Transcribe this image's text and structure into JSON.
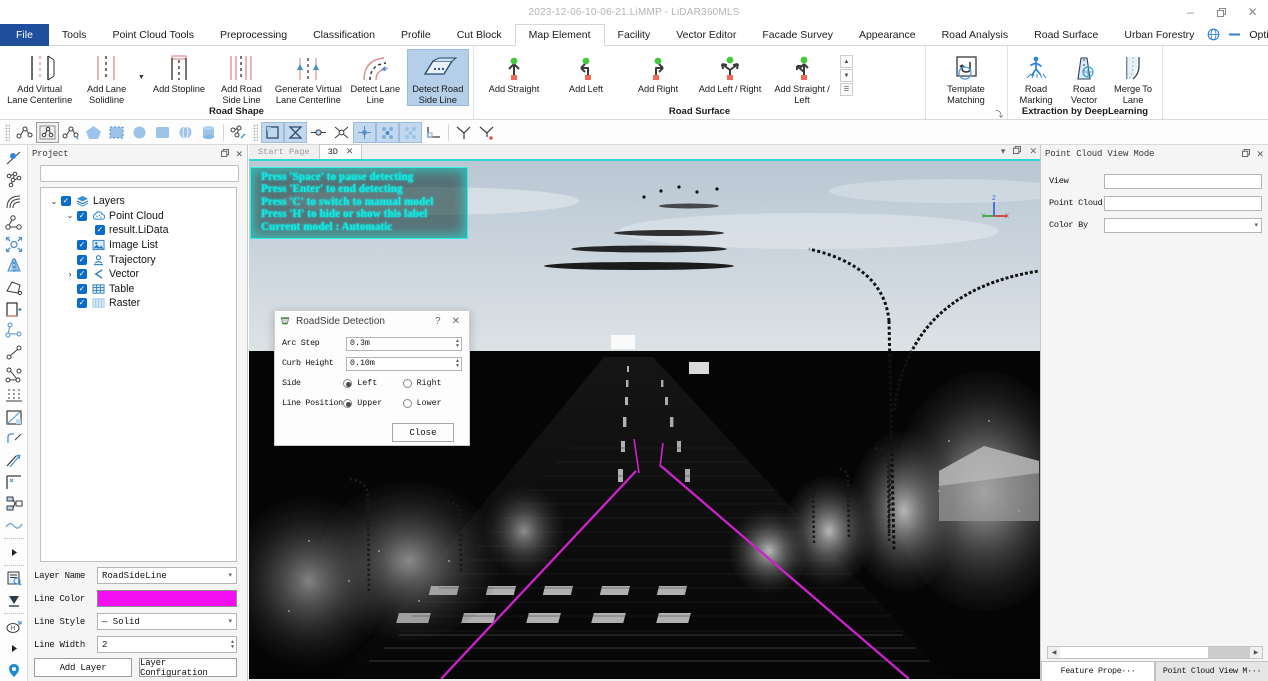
{
  "window": {
    "title": "2023-12-06-10-06-21.LiMMP - LiDAR360MLS",
    "minimize": "–",
    "restore": "❐",
    "close": "✕"
  },
  "ribbon_tabs": {
    "file": "File",
    "items": [
      {
        "label": "Tools",
        "active": false
      },
      {
        "label": "Point Cloud Tools",
        "active": false
      },
      {
        "label": "Preprocessing",
        "active": false
      },
      {
        "label": "Classification",
        "active": false
      },
      {
        "label": "Profile",
        "active": false
      },
      {
        "label": "Cut Block",
        "active": false
      },
      {
        "label": "Map Element",
        "active": true
      },
      {
        "label": "Facility",
        "active": false
      },
      {
        "label": "Vector Editor",
        "active": false
      },
      {
        "label": "Facade Survey",
        "active": false
      },
      {
        "label": "Appearance",
        "active": false
      },
      {
        "label": "Road Analysis",
        "active": false
      },
      {
        "label": "Road Surface",
        "active": false
      },
      {
        "label": "Urban Forestry",
        "active": false
      }
    ],
    "help_icon": "help-globe-icon",
    "minus_icon": "collapse-ribbon-icon",
    "options": "Options",
    "options_caret": "▾"
  },
  "ribbon_groups": [
    {
      "title": "Road Shape",
      "buttons": [
        {
          "label": "Add Virtual Lane Centerline",
          "icon": "lane-centerline-icon",
          "selected": false
        },
        {
          "label": "Add Lane Solidline",
          "icon": "lane-solidline-icon",
          "selected": false,
          "has_dropdown": true
        },
        {
          "label": "Add Stopline",
          "icon": "stopline-icon",
          "selected": false
        },
        {
          "label": "Add Road Side Line",
          "icon": "road-side-line-icon",
          "selected": false
        },
        {
          "label": "Generate Virtual Lane Centerline",
          "icon": "generate-virtual-centerline-icon",
          "selected": false
        },
        {
          "label": "Detect Lane Line",
          "icon": "detect-lane-line-icon",
          "selected": false
        },
        {
          "label": "Detect Road Side Line",
          "icon": "detect-road-side-line-icon",
          "selected": true
        }
      ]
    },
    {
      "title": "Road Surface",
      "buttons": [
        {
          "label": "Add Straight",
          "icon": "arrow-straight-icon",
          "selected": false
        },
        {
          "label": "Add Left",
          "icon": "arrow-left-icon",
          "selected": false
        },
        {
          "label": "Add Right",
          "icon": "arrow-right-icon",
          "selected": false
        },
        {
          "label": "Add Left / Right",
          "icon": "arrow-left-right-icon",
          "selected": false
        },
        {
          "label": "Add Straight / Left",
          "icon": "arrow-straight-left-icon",
          "selected": false
        }
      ],
      "has_gallery_scroll": true,
      "scroll_up": "▲",
      "scroll_down": "▼",
      "scroll_more": "☰"
    },
    {
      "title": "",
      "buttons": [
        {
          "label": "Template Matching",
          "icon": "template-matching-icon",
          "selected": false
        }
      ],
      "launcher": "⤵"
    },
    {
      "title": "Extraction by DeepLearning",
      "buttons": [
        {
          "label": "Road Marking",
          "icon": "road-marking-icon",
          "selected": false
        },
        {
          "label": "Road Vector",
          "icon": "road-vector-icon",
          "selected": false
        },
        {
          "label": "Merge To Lane",
          "icon": "merge-to-lane-icon",
          "selected": false
        }
      ]
    }
  ],
  "toolbar2": {
    "groups": [
      [
        "measure-polyline-icon",
        "measure-area-boxed-icon",
        "measure-angle-icon"
      ],
      [
        "polygon-select-icon",
        "rect-dashed-select-icon",
        "circle-select-icon",
        "square-select-icon",
        "sphere-select-icon",
        "cylinder-select-icon"
      ],
      [
        "edit-node-icon"
      ],
      [
        "box-view-icon",
        "hourglass-view-icon",
        "point-line-icon",
        "cross-node-icon",
        "diamond-node-icon",
        "dots-grid-icon",
        "dots-grid2-icon",
        "axis-corner-icon"
      ],
      [
        "angle-tool-icon",
        "angle-point-tool-icon"
      ]
    ],
    "active_indices": [
      0,
      1,
      4,
      5,
      6
    ]
  },
  "left_toolbar": {
    "icons": [
      "pick-point-icon",
      "point-chain-icon",
      "arc-icon",
      "node-link-icon",
      "expand-circle-icon",
      "mirror-icon",
      "polygon-edit-icon",
      "door-panel-icon",
      "node-tree-icon",
      "line-node-icon",
      "node-triangle-icon",
      "vertical-lines-icon",
      "rect-diagonal-icon",
      "curve-corner-icon",
      "arrow-line-icon",
      "corner-frame-icon",
      "hierarchy-icon",
      "wave-line-icon",
      "play-small-icon",
      "table-search-icon",
      "download-cloud-icon",
      "heading-cloud-icon",
      "play-small2-icon",
      "location-pin-icon"
    ]
  },
  "project_panel": {
    "title": "Project",
    "float_icon": "❐",
    "close_icon": "✕",
    "search_value": "",
    "tree": [
      {
        "label": "Layers",
        "depth": 0,
        "expander": "⌄",
        "checked": true,
        "icon": "layers-icon"
      },
      {
        "label": "Point Cloud",
        "depth": 1,
        "expander": "⌄",
        "checked": true,
        "icon": "point-cloud-icon"
      },
      {
        "label": "result.LiData",
        "depth": 2,
        "expander": "",
        "checked": true,
        "icon": ""
      },
      {
        "label": "Image List",
        "depth": 1,
        "expander": "",
        "checked": true,
        "icon": "image-list-icon"
      },
      {
        "label": "Trajectory",
        "depth": 1,
        "expander": "",
        "checked": true,
        "icon": "trajectory-icon"
      },
      {
        "label": "Vector",
        "depth": 1,
        "expander": "›",
        "checked": true,
        "icon": "vector-icon"
      },
      {
        "label": "Table",
        "depth": 1,
        "expander": "",
        "checked": true,
        "icon": "table-icon"
      },
      {
        "label": "Raster",
        "depth": 1,
        "expander": "",
        "checked": true,
        "icon": "raster-icon"
      }
    ]
  },
  "layer_props": {
    "layer_name_label": "Layer Name",
    "layer_name_value": "RoadSideLine",
    "line_color_label": "Line Color",
    "line_color_value": "#f40ef4",
    "line_style_label": "Line Style",
    "line_style_value": "— Solid",
    "line_width_label": "Line Width",
    "line_width_value": "2",
    "add_layer": "Add Layer",
    "layer_configuration": "Layer Configuration",
    "caret": "▾",
    "spin_up": "▲",
    "spin_down": "▼"
  },
  "doc_tabs": {
    "tabs": [
      {
        "label": "Start Page",
        "active": false,
        "closable": false
      },
      {
        "label": "3D",
        "active": true,
        "closable": true
      }
    ],
    "close_glyph": "✕",
    "menu_glyph": "▾",
    "float_glyph": "❐",
    "close_panel_glyph": "✕"
  },
  "viewport": {
    "hint_lines": [
      "Press 'Space' to pause detecting",
      "Press 'Enter' to end detecting",
      "Press 'C' to switch to manual model",
      "Press 'H' to hide or show this label",
      "Current model : Automatic"
    ],
    "hint_color": "#0fe9df",
    "axis_labels": {
      "z": "Z",
      "y": "Y",
      "x": "X"
    },
    "line_color": "#cc22cc"
  },
  "dialog": {
    "title": "RoadSide Detection",
    "app_icon": "roadside-detection-icon",
    "help_glyph": "?",
    "close_glyph": "✕",
    "fields": [
      {
        "label": "Arc Step",
        "value": "0.3m"
      },
      {
        "label": "Curb Height",
        "value": "0.10m"
      }
    ],
    "radio_groups": [
      {
        "label": "Side",
        "options": [
          {
            "label": "Left",
            "selected": true
          },
          {
            "label": "Right",
            "selected": false
          }
        ]
      },
      {
        "label": "Line Position",
        "options": [
          {
            "label": "Upper",
            "selected": true
          },
          {
            "label": "Lower",
            "selected": false
          }
        ]
      }
    ],
    "close_button": "Close",
    "spin_up": "▲",
    "spin_down": "▼"
  },
  "right_panel": {
    "title": "Point Cloud View Mode",
    "float_icon": "❐",
    "close_icon": "✕",
    "rows": [
      {
        "label": "View",
        "value": "",
        "combo": false
      },
      {
        "label": "Point Cloud",
        "value": "",
        "combo": false
      },
      {
        "label": "Color By",
        "value": "",
        "combo": true
      }
    ],
    "scroll_left": "◀",
    "scroll_right": "▶",
    "tabs": [
      {
        "label": "Feature Prope···",
        "active": true
      },
      {
        "label": "Point Cloud View M···",
        "active": false
      }
    ]
  }
}
